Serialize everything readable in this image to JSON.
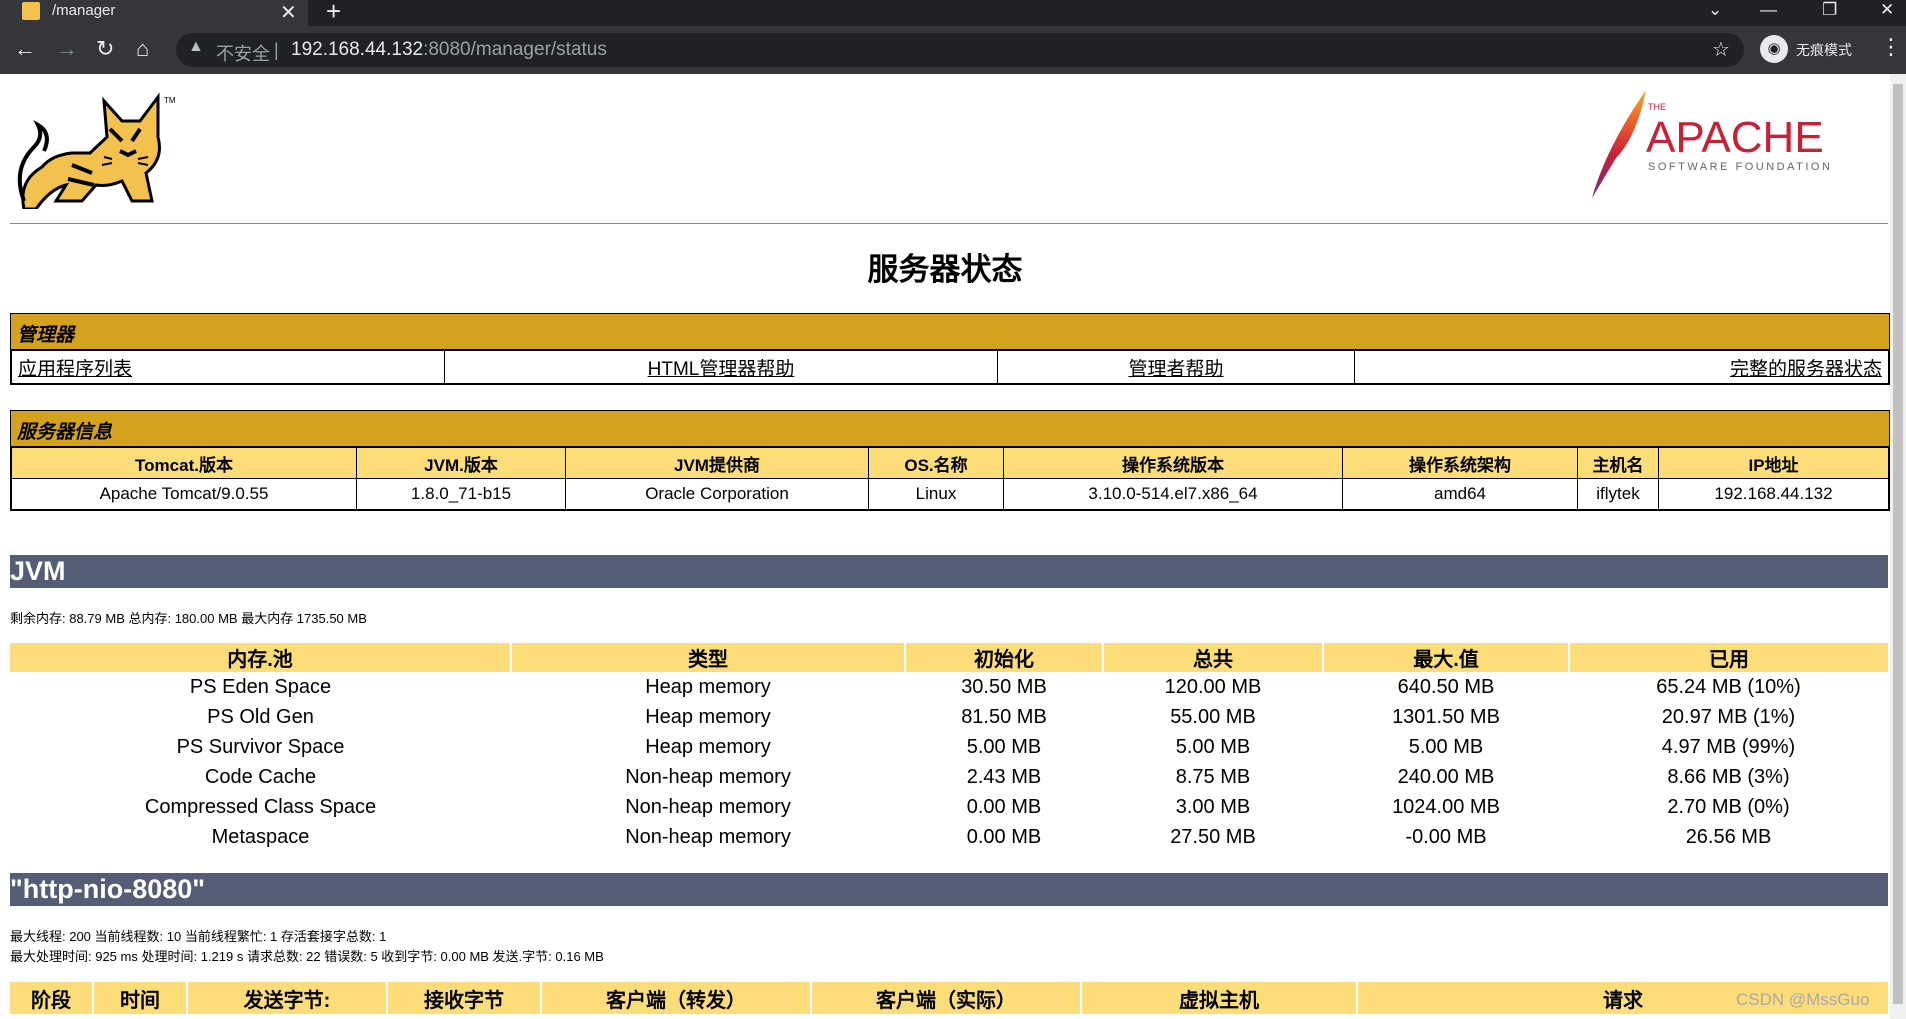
{
  "browser": {
    "tab_title": "/manager",
    "security_label": "不安全",
    "url_host": "192.168.44.132",
    "url_path": ":8080/manager/status",
    "incognito_label": "无痕模式"
  },
  "page": {
    "title": "服务器状态",
    "apache_small": "THE",
    "apache_big": "APACHE",
    "apache_sub": "SOFTWARE FOUNDATION",
    "tm": "TM",
    "watermark": "CSDN @MssGuo"
  },
  "manager": {
    "header": "管理器",
    "links": [
      "应用程序列表",
      "HTML管理器帮助",
      "管理者帮助",
      "完整的服务器状态"
    ]
  },
  "server_info": {
    "header": "服务器信息",
    "columns": [
      "Tomcat.版本",
      "JVM.版本",
      "JVM提供商",
      "OS.名称",
      "操作系统版本",
      "操作系统架构",
      "主机名",
      "IP地址"
    ],
    "values": [
      "Apache Tomcat/9.0.55",
      "1.8.0_71-b15",
      "Oracle Corporation",
      "Linux",
      "3.10.0-514.el7.x86_64",
      "amd64",
      "iflytek",
      "192.168.44.132"
    ]
  },
  "jvm": {
    "title": "JVM",
    "summary": "剩余内存:   88.79 MB 总内存:   180.00 MB 最大内存 1735.50 MB",
    "columns": [
      "内存.池",
      "类型",
      "初始化",
      "总共",
      "最大.值",
      "已用"
    ],
    "rows": [
      [
        "PS Eden Space",
        "Heap memory",
        "30.50 MB",
        "120.00 MB",
        "640.50 MB",
        "65.24 MB (10%)"
      ],
      [
        "PS Old Gen",
        "Heap memory",
        "81.50 MB",
        "55.00 MB",
        "1301.50 MB",
        "20.97 MB (1%)"
      ],
      [
        "PS Survivor Space",
        "Heap memory",
        "5.00 MB",
        "5.00 MB",
        "5.00 MB",
        "4.97 MB (99%)"
      ],
      [
        "Code Cache",
        "Non-heap memory",
        "2.43 MB",
        "8.75 MB",
        "240.00 MB",
        "8.66 MB (3%)"
      ],
      [
        "Compressed Class Space",
        "Non-heap memory",
        "0.00 MB",
        "3.00 MB",
        "1024.00 MB",
        "2.70 MB (0%)"
      ],
      [
        "Metaspace",
        "Non-heap memory",
        "0.00 MB",
        "27.50 MB",
        "-0.00 MB",
        "26.56 MB"
      ]
    ]
  },
  "connector": {
    "title": "\"http-nio-8080\"",
    "line1": "最大线程:   200 当前线程数:   10 当前线程繁忙:   1 存活套接字总数:   1",
    "line2": "最大处理时间:   925 ms 处理时间:   1.219 s 请求总数:   22 错误数:   5 收到字节:   0.00 MB 发送.字节: 0.16 MB",
    "columns": [
      "阶段",
      "时间",
      "发送字节:",
      "接收字节",
      "客户端（转发）",
      "客户端（实际）",
      "虚拟主机",
      "请求"
    ]
  }
}
